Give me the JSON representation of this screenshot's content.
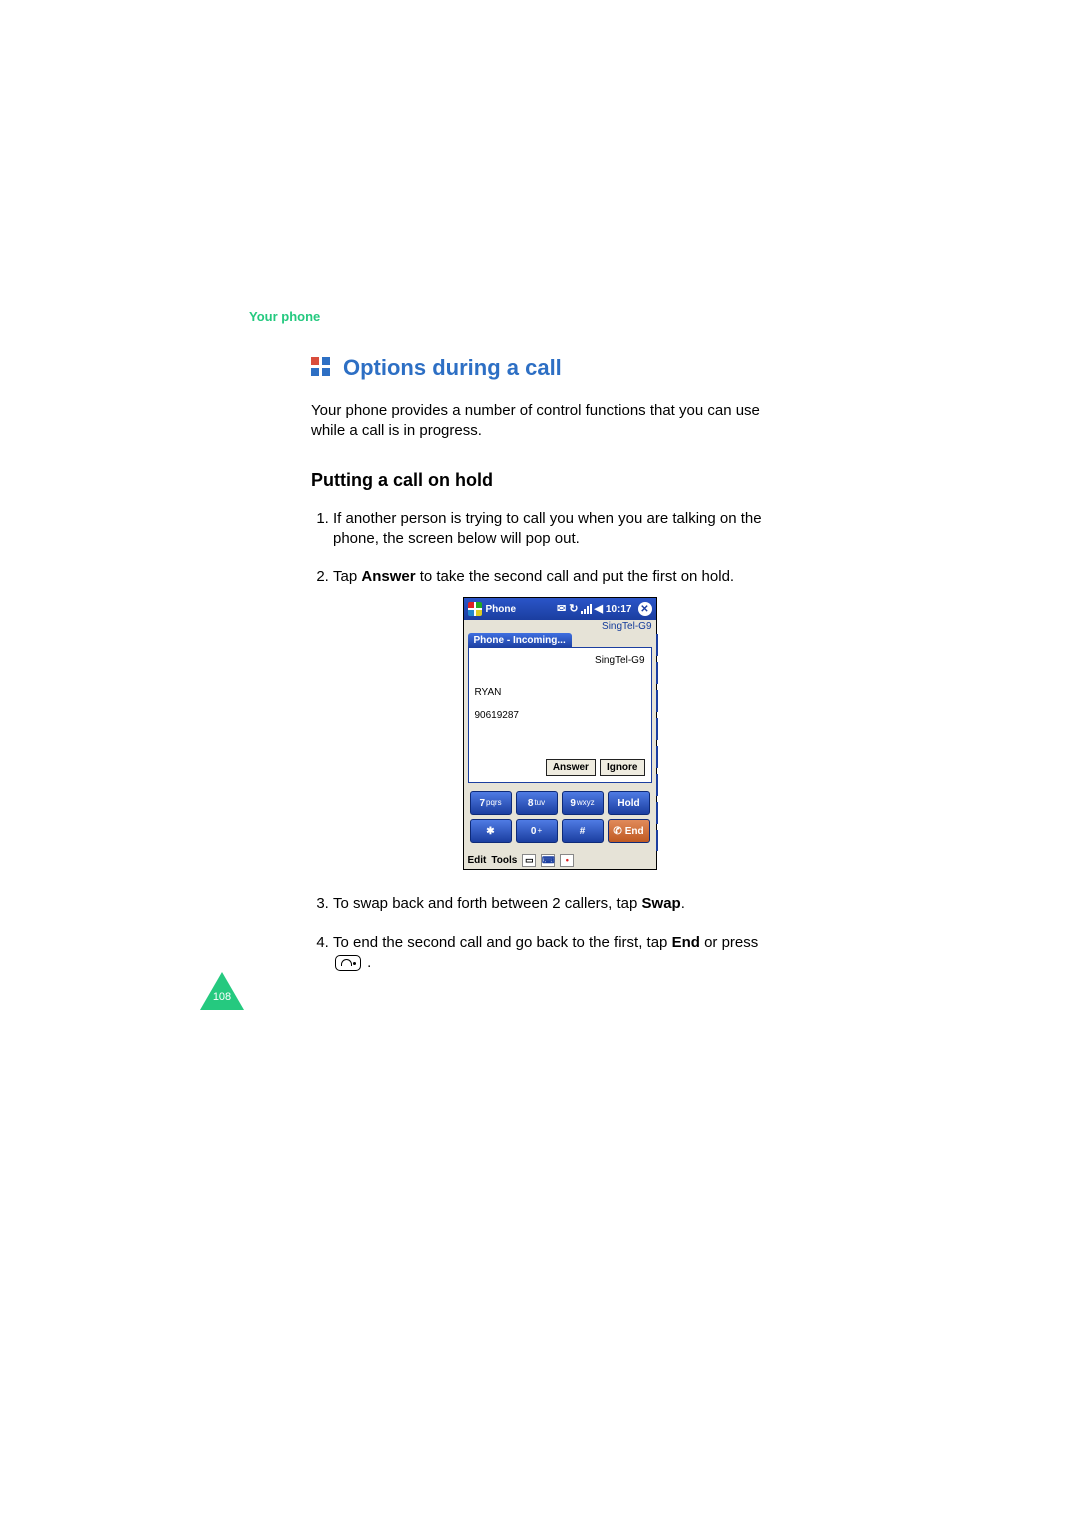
{
  "breadcrumb": "Your phone",
  "heading": "Options during a call",
  "intro": "Your phone provides a number of control functions that you can use while a call is in progress.",
  "section_title": "Putting a call on hold",
  "steps": {
    "s1": "If another person is trying to call you when you are talking on the phone, the screen below will pop out.",
    "s2_a": "Tap ",
    "s2_b": "Answer",
    "s2_c": " to take the second call and put the first on hold.",
    "s3_a": "To swap back and forth between 2 callers, tap ",
    "s3_b": "Swap",
    "s3_c": ".",
    "s4_a": "To end the second call and go back to the first, tap ",
    "s4_b": "End",
    "s4_c": " or press ",
    "s4_d": " ."
  },
  "screenshot": {
    "title": "Phone",
    "time": "10:17",
    "carrier_top": "SingTel-G9",
    "incoming_tab": "Phone - Incoming...",
    "carrier_popup": "SingTel-G9",
    "caller_name": "RYAN",
    "caller_number": "90619287",
    "btn_answer": "Answer",
    "btn_ignore": "Ignore",
    "keys": {
      "k7": "7",
      "k7s": "pqrs",
      "k8": "8",
      "k8s": "tuv",
      "k9": "9",
      "k9s": "wxyz",
      "hold": "Hold",
      "star": "✱",
      "k0": "0",
      "k0s": "+",
      "hash": "#",
      "end": "End"
    },
    "bottom": {
      "edit": "Edit",
      "tools": "Tools"
    }
  },
  "page_number": "108"
}
